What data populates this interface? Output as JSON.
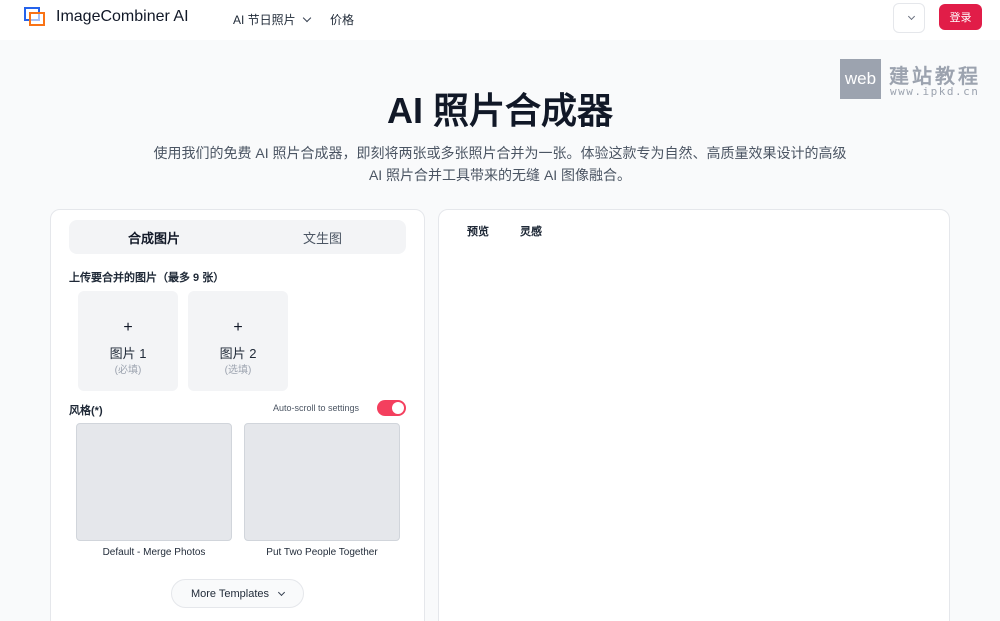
{
  "header": {
    "brand": "ImageCombiner AI",
    "nav": [
      {
        "label": "AI 节日照片",
        "icon": "chevron-down-icon"
      },
      {
        "label": "价格"
      }
    ],
    "login_label": "登录",
    "lang_icon": "chevron-down-icon",
    "accent": "#e11d48"
  },
  "watermark": {
    "box_text": "web",
    "title": "建站教程",
    "url": "www.ipkd.cn"
  },
  "hero": {
    "title": "AI 照片合成器",
    "desc_line1": "使用我们的免费 AI 照片合成器，即刻将两张或多张照片合并为一张。体验这款专为自然、高质量效果设计的高级",
    "desc_line2": "AI 照片合并工具带来的无缝 AI 图像融合。"
  },
  "left_panel": {
    "tabs": [
      "合成图片",
      "文生图"
    ],
    "upload_label": "上传要合并的图片（最多 9 张）",
    "slots": [
      {
        "plus": "+",
        "name": "图片 1",
        "hint": "(必填)"
      },
      {
        "plus": "+",
        "name": "图片 2",
        "hint": "(选填)"
      }
    ],
    "style_label": "风格(*)",
    "autoscroll_label": "Auto-scroll to settings",
    "autoscroll_on": true,
    "templates": [
      "Default - Merge Photos",
      "Put Two People Together"
    ],
    "more_label": "More Templates"
  },
  "right_panel": {
    "tabs": [
      "预览",
      "灵感"
    ]
  }
}
